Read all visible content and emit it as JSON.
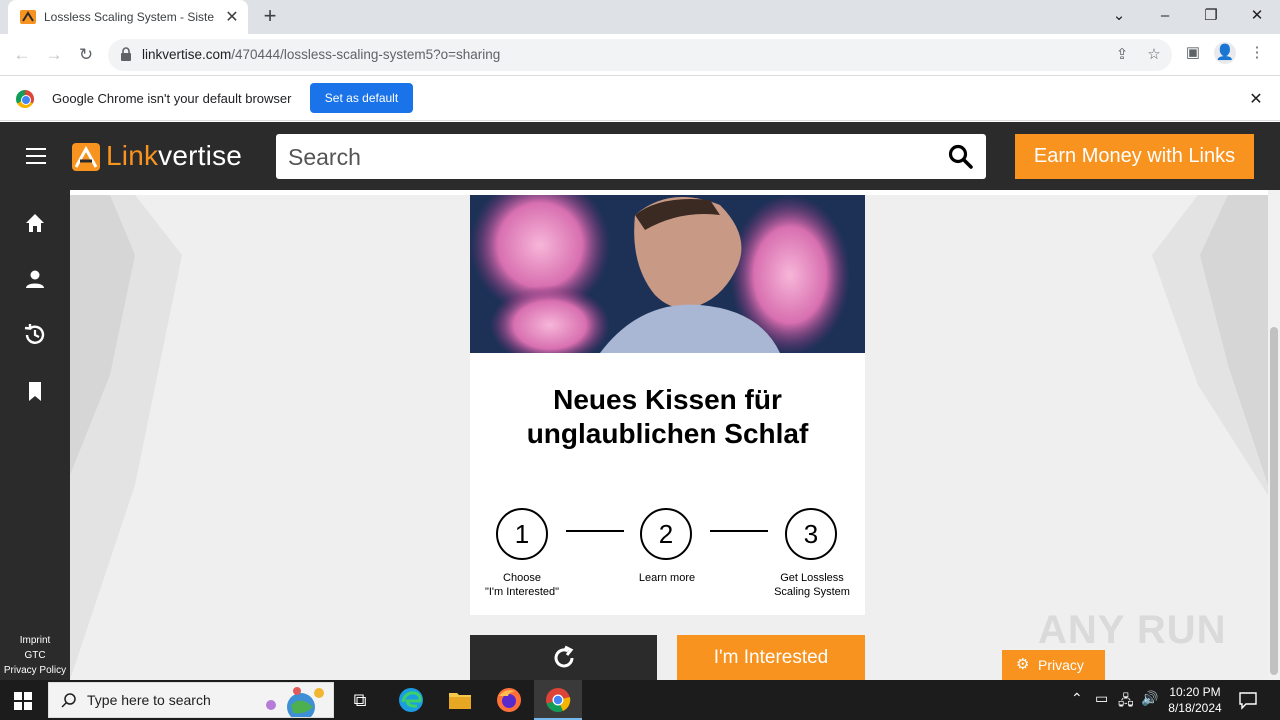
{
  "browser": {
    "tab_title": "Lossless Scaling System - Sistem",
    "url_domain": "linkvertise.com",
    "url_path": "/470444/lossless-scaling-system5?o=sharing"
  },
  "infobar": {
    "message": "Google Chrome isn't your default browser",
    "button": "Set as default"
  },
  "header": {
    "logo_link": "Link",
    "logo_vertise": "vertise",
    "search_placeholder": "Search",
    "earn_button": "Earn Money with Links"
  },
  "sidebar": {
    "icons": [
      "home-icon",
      "user-icon",
      "history-icon",
      "bookmark-icon"
    ],
    "footer": [
      "Imprint",
      "GTC",
      "Privacy Policy"
    ]
  },
  "card": {
    "title_line1": "Neues Kissen für",
    "title_line2": "unglaublichen Schlaf",
    "steps": [
      {
        "num": "1",
        "label1": "Choose",
        "label2": "\"I'm Interested\""
      },
      {
        "num": "2",
        "label1": "Learn more",
        "label2": ""
      },
      {
        "num": "3",
        "label1": "Get Lossless",
        "label2": "Scaling System"
      }
    ]
  },
  "actions": {
    "interested": "I'm Interested",
    "privacy": "Privacy"
  },
  "watermark": "ANY RUN",
  "taskbar": {
    "search_placeholder": "Type here to search",
    "time": "10:20 PM",
    "date": "8/18/2024"
  },
  "colors": {
    "accent": "#f7931e",
    "dark": "#2b2b2b",
    "chrome_blue": "#1a73e8"
  }
}
